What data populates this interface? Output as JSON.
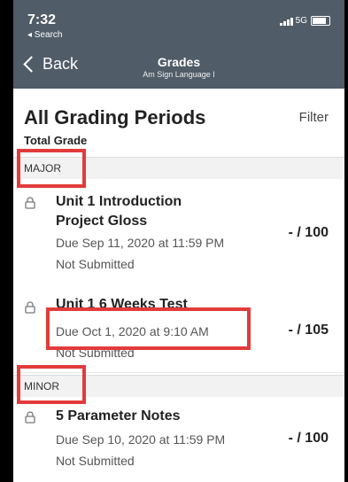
{
  "status_bar": {
    "time": "7:32",
    "back_app": "◂ Search",
    "network": "5G"
  },
  "nav": {
    "back_label": "Back",
    "title": "Grades",
    "subtitle": "Am Sign Language I"
  },
  "header": {
    "title": "All Grading Periods",
    "filter_label": "Filter",
    "total_label": "Total Grade"
  },
  "sections": [
    {
      "label": "MAJOR",
      "items": [
        {
          "title_line1": "Unit 1 Introduction",
          "title_line2": "Project Gloss",
          "due": "Due Sep 11, 2020 at 11:59 PM",
          "status": "Not Submitted",
          "score": "- / 100"
        },
        {
          "title_line1": "Unit 1 6 Weeks Test",
          "due": "Due Oct 1, 2020 at 9:10 AM",
          "status": "Not Submitted",
          "score": "- / 105"
        }
      ]
    },
    {
      "label": "MINOR",
      "items": [
        {
          "title_line1": "5 Parameter Notes",
          "due": "Due Sep 10, 2020 at 11:59 PM",
          "status": "Not Submitted",
          "score": "- / 100"
        }
      ]
    }
  ],
  "colors": {
    "topbar": "#505c67",
    "highlight": "#e23b3b"
  }
}
